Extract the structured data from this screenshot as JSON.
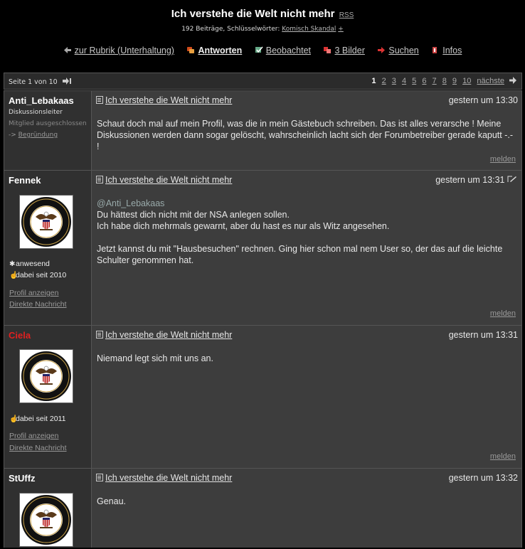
{
  "header": {
    "title": "Ich verstehe die Welt nicht mehr",
    "rss": "RSS",
    "posts_count": "192 Beiträge, Schlüsselwörter:",
    "keywords": "Komisch Skandal",
    "keyword_add": "+"
  },
  "nav": [
    {
      "label": "zur Rubrik (Unterhaltung)",
      "icon": "arrow-left-icon"
    },
    {
      "label": "Antworten",
      "icon": "reply-icon"
    },
    {
      "label": "Beobachtet",
      "icon": "watch-icon"
    },
    {
      "label": "3 Bilder",
      "icon": "images-icon"
    },
    {
      "label": "Suchen",
      "icon": "search-icon"
    },
    {
      "label": "Infos",
      "icon": "info-icon"
    }
  ],
  "pager": {
    "page_info": "Seite 1 von 10",
    "current": "1",
    "pages": [
      "2",
      "3",
      "4",
      "5",
      "6",
      "7",
      "8",
      "9",
      "10"
    ],
    "next": "nächste"
  },
  "posts": [
    {
      "author": "Anti_Lebakaas",
      "role": "Diskussionsleiter",
      "excluded": "Mitglied ausgeschlossen",
      "reason_prefix": "->",
      "reason": "Begründung",
      "title": "Ich verstehe die Welt nicht mehr",
      "time": "gestern um 13:30",
      "text": "Schaut doch mal auf mein Profil, was die in mein Gästebuch schreiben. Das ist alles verarsche ! Meine Diskussionen werden dann sogar gelöscht, wahrscheinlich lacht sich der Forumbetreiber gerade kaputt -.- !",
      "report": "melden"
    },
    {
      "author": "Fennek",
      "status": "anwesend",
      "since": "dabei seit 2010",
      "profile": "Profil anzeigen",
      "message": "Direkte Nachricht",
      "title": "Ich verstehe die Welt nicht mehr",
      "time": "gestern um 13:31",
      "quote": "@Anti_Lebakaas",
      "line1": "Du hättest dich nicht mit der NSA anlegen sollen.",
      "line2": "Ich habe dich mehrmals gewarnt, aber du hast es nur als Witz angesehen.",
      "line3": "Jetzt kannst du mit \"Hausbesuchen\" rechnen. Ging hier schon mal nem User so, der das auf die leichte Schulter genommen hat.",
      "report": "melden"
    },
    {
      "author": "Ciela",
      "since": "dabei seit 2011",
      "profile": "Profil anzeigen",
      "message": "Direkte Nachricht",
      "title": "Ich verstehe die Welt nicht mehr",
      "time": "gestern um 13:31",
      "text": "Niemand legt sich mit uns an.",
      "report": "melden"
    },
    {
      "author": "StUffz",
      "title": "Ich verstehe die Welt nicht mehr",
      "time": "gestern um 13:32",
      "text": "Genau."
    }
  ]
}
